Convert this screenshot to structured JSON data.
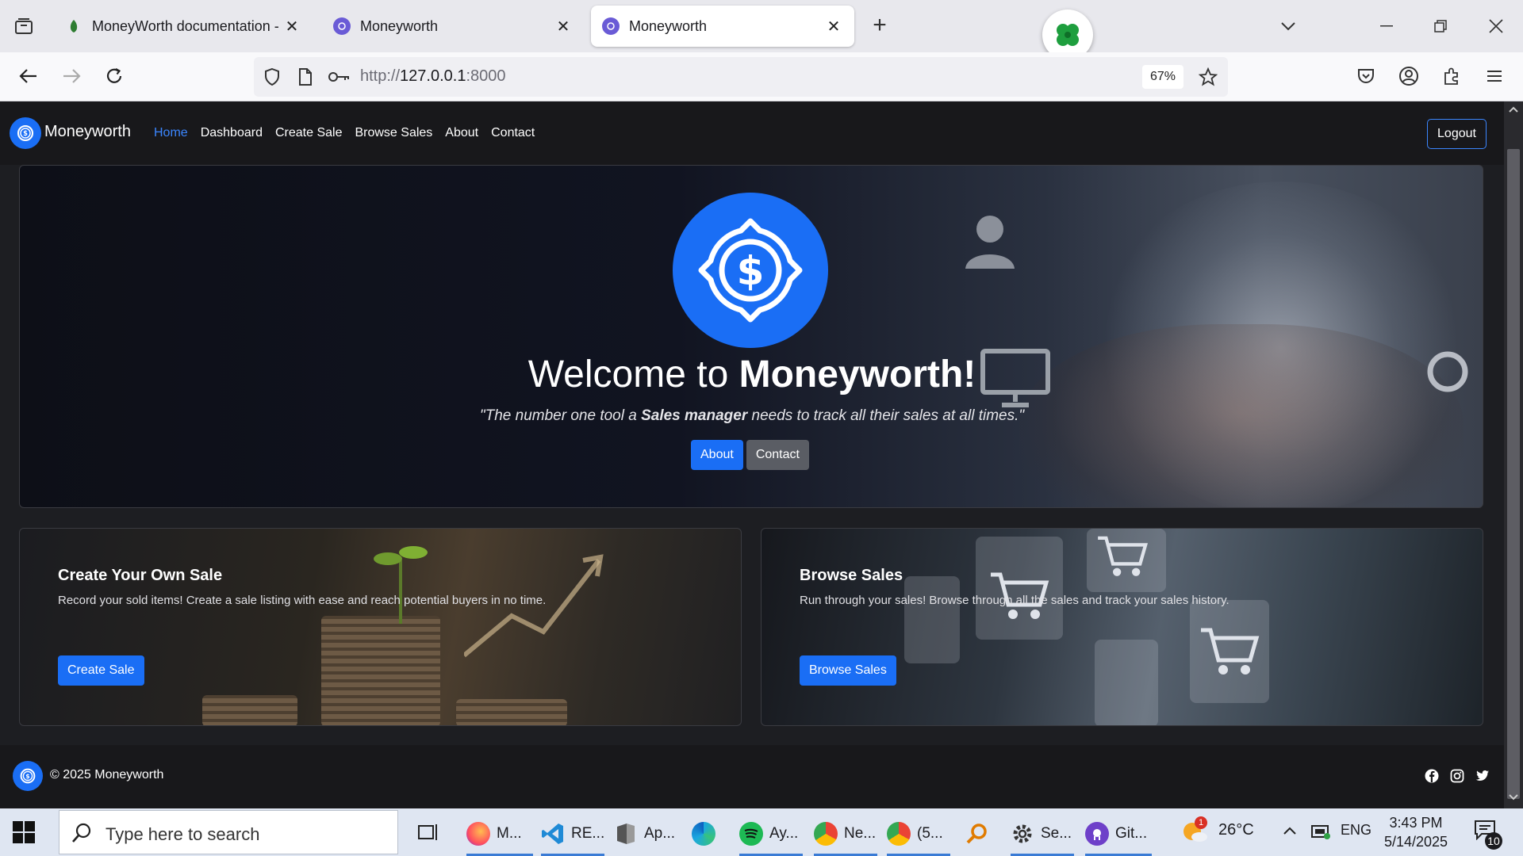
{
  "browser": {
    "tabs": [
      {
        "title": "MoneyWorth documentation - (",
        "active": false
      },
      {
        "title": "Moneyworth",
        "active": false
      },
      {
        "title": "Moneyworth",
        "active": true
      }
    ],
    "url_prefix": "http://",
    "url_host": "127.0.0.1",
    "url_suffix": ":8000",
    "zoom": "67%"
  },
  "site": {
    "brand": "Moneyworth",
    "nav": [
      "Home",
      "Dashboard",
      "Create Sale",
      "Browse Sales",
      "About",
      "Contact"
    ],
    "active_nav": "Home",
    "logout": "Logout"
  },
  "hero": {
    "title_plain": "Welcome to ",
    "title_bold": "Moneyworth!",
    "quote_before": "\"The number one tool a ",
    "quote_bold": "Sales manager",
    "quote_after": " needs to track all their sales at all times.\"",
    "btn_about": "About",
    "btn_contact": "Contact"
  },
  "cards": [
    {
      "title": "Create Your Own Sale",
      "text": "Record your sold items! Create a sale listing with ease and reach potential buyers in no time.",
      "button": "Create Sale"
    },
    {
      "title": "Browse Sales",
      "text": "Run through your sales! Browse through all the sales and track your sales history.",
      "button": "Browse Sales"
    }
  ],
  "footer": {
    "text": "© 2025 Moneyworth",
    "social_icons": [
      "facebook-icon",
      "instagram-icon",
      "twitter-icon"
    ]
  },
  "taskbar": {
    "search_placeholder": "Type here to search",
    "apps": [
      {
        "label": "M...",
        "icon": "firefox-icon"
      },
      {
        "label": "RE...",
        "icon": "vscode-icon"
      },
      {
        "label": "Ap...",
        "icon": "file-app-icon"
      },
      {
        "label": "",
        "icon": "edge-icon"
      },
      {
        "label": "Ay...",
        "icon": "spotify-icon"
      },
      {
        "label": "Ne...",
        "icon": "chrome-icon"
      },
      {
        "label": "(5...",
        "icon": "chrome-icon"
      },
      {
        "label": "",
        "icon": "magnifier-icon"
      },
      {
        "label": "Se...",
        "icon": "settings-icon"
      },
      {
        "label": "Git...",
        "icon": "github-icon"
      }
    ],
    "weather_temp": "26°C",
    "weather_badge": "1",
    "language": "ENG",
    "time": "3:43 PM",
    "date": "5/14/2025",
    "notifications": "10"
  },
  "colors": {
    "accent": "#1a6ef5",
    "nav_active": "#3b86ff",
    "secondary_button": "#5a5d64"
  }
}
